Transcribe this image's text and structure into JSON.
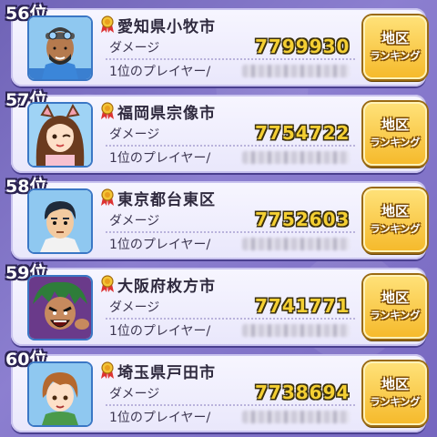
{
  "labels": {
    "damage": "ダメージ",
    "top_player": "1位のプレイヤー/",
    "button_line1": "地区",
    "button_line2": "ランキング"
  },
  "rows": [
    {
      "rank": "56位",
      "area": "愛知県小牧市",
      "damage": "7799930",
      "avatar": "man-goggles-beard"
    },
    {
      "rank": "57位",
      "area": "福岡県宗像市",
      "damage": "7754722",
      "avatar": "girl-cat-ears-winking"
    },
    {
      "rank": "58位",
      "area": "東京都台東区",
      "damage": "7752603",
      "avatar": "boy-dark-hair"
    },
    {
      "rank": "59位",
      "area": "大阪府枚方市",
      "damage": "7741771",
      "avatar": "green-hair-shouting"
    },
    {
      "rank": "60位",
      "area": "埼玉県戸田市",
      "damage": "7738694",
      "avatar": "boy-brown-hair"
    }
  ],
  "colors": {
    "background": "#7a6cc4",
    "damage_value": "#f4cf33",
    "button": "#f5b92a"
  }
}
